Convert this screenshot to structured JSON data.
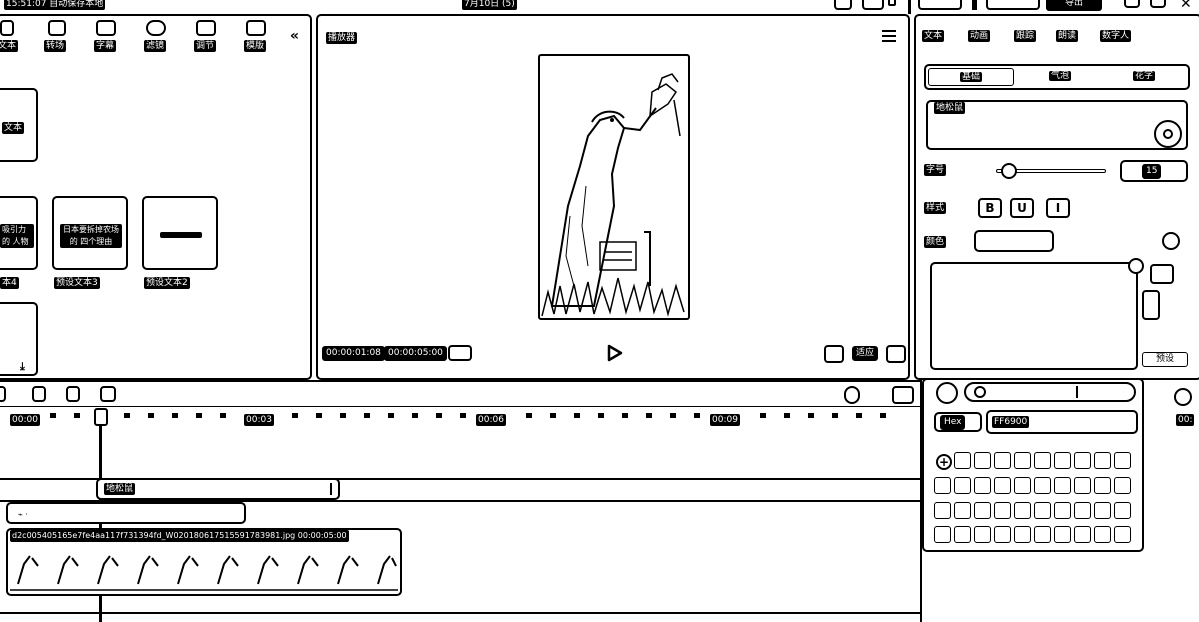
{
  "titlebar": {
    "save_status": "15:51:07 自动保存本地",
    "project_title": "7月10日 (5)",
    "btn_a": "",
    "btn_b": "",
    "btn_export": "导出"
  },
  "toolbar": {
    "items": [
      {
        "label": "文本"
      },
      {
        "label": "转场"
      },
      {
        "label": "字幕"
      },
      {
        "label": "滤镜"
      },
      {
        "label": "调节"
      },
      {
        "label": "模版"
      }
    ]
  },
  "library": {
    "card1_text": "文本",
    "card2_text": "吸引力的 人物",
    "card3_text": "日本要拆掉农场的 四个理由",
    "card4_text": "",
    "caption_a": "本4",
    "caption_b": "预设文本3",
    "caption_c": "预设文本2"
  },
  "player": {
    "title": "播放器",
    "current_time": "00:00:01:08",
    "total_time": "00:00:05:00",
    "ratio_label": "适应"
  },
  "inspector": {
    "tabs": [
      "文本",
      "动画",
      "跟踪",
      "朗读",
      "数字人"
    ],
    "subtabs": [
      "基础",
      "气泡",
      "花字"
    ],
    "text_value": "地松鼠",
    "size_label": "字号",
    "size_value": "15",
    "size_fraction": 0.05,
    "style_label": "样式",
    "style_buttons": [
      "B",
      "U",
      "I"
    ],
    "color_label": "颜色",
    "preset_button": "预设",
    "hex_mode": "Hex",
    "hex_value": "FF6900"
  },
  "timeline": {
    "tick_labels": [
      "00:00",
      "00:03",
      "00:06",
      "00:09",
      "00:"
    ],
    "text_clip": "地松鼠",
    "audio_clip": "",
    "video_clip_label": "d2c005405165e7fe4aa117f731394fd_W020180617515591783981.jpg  00:00:05:00"
  }
}
